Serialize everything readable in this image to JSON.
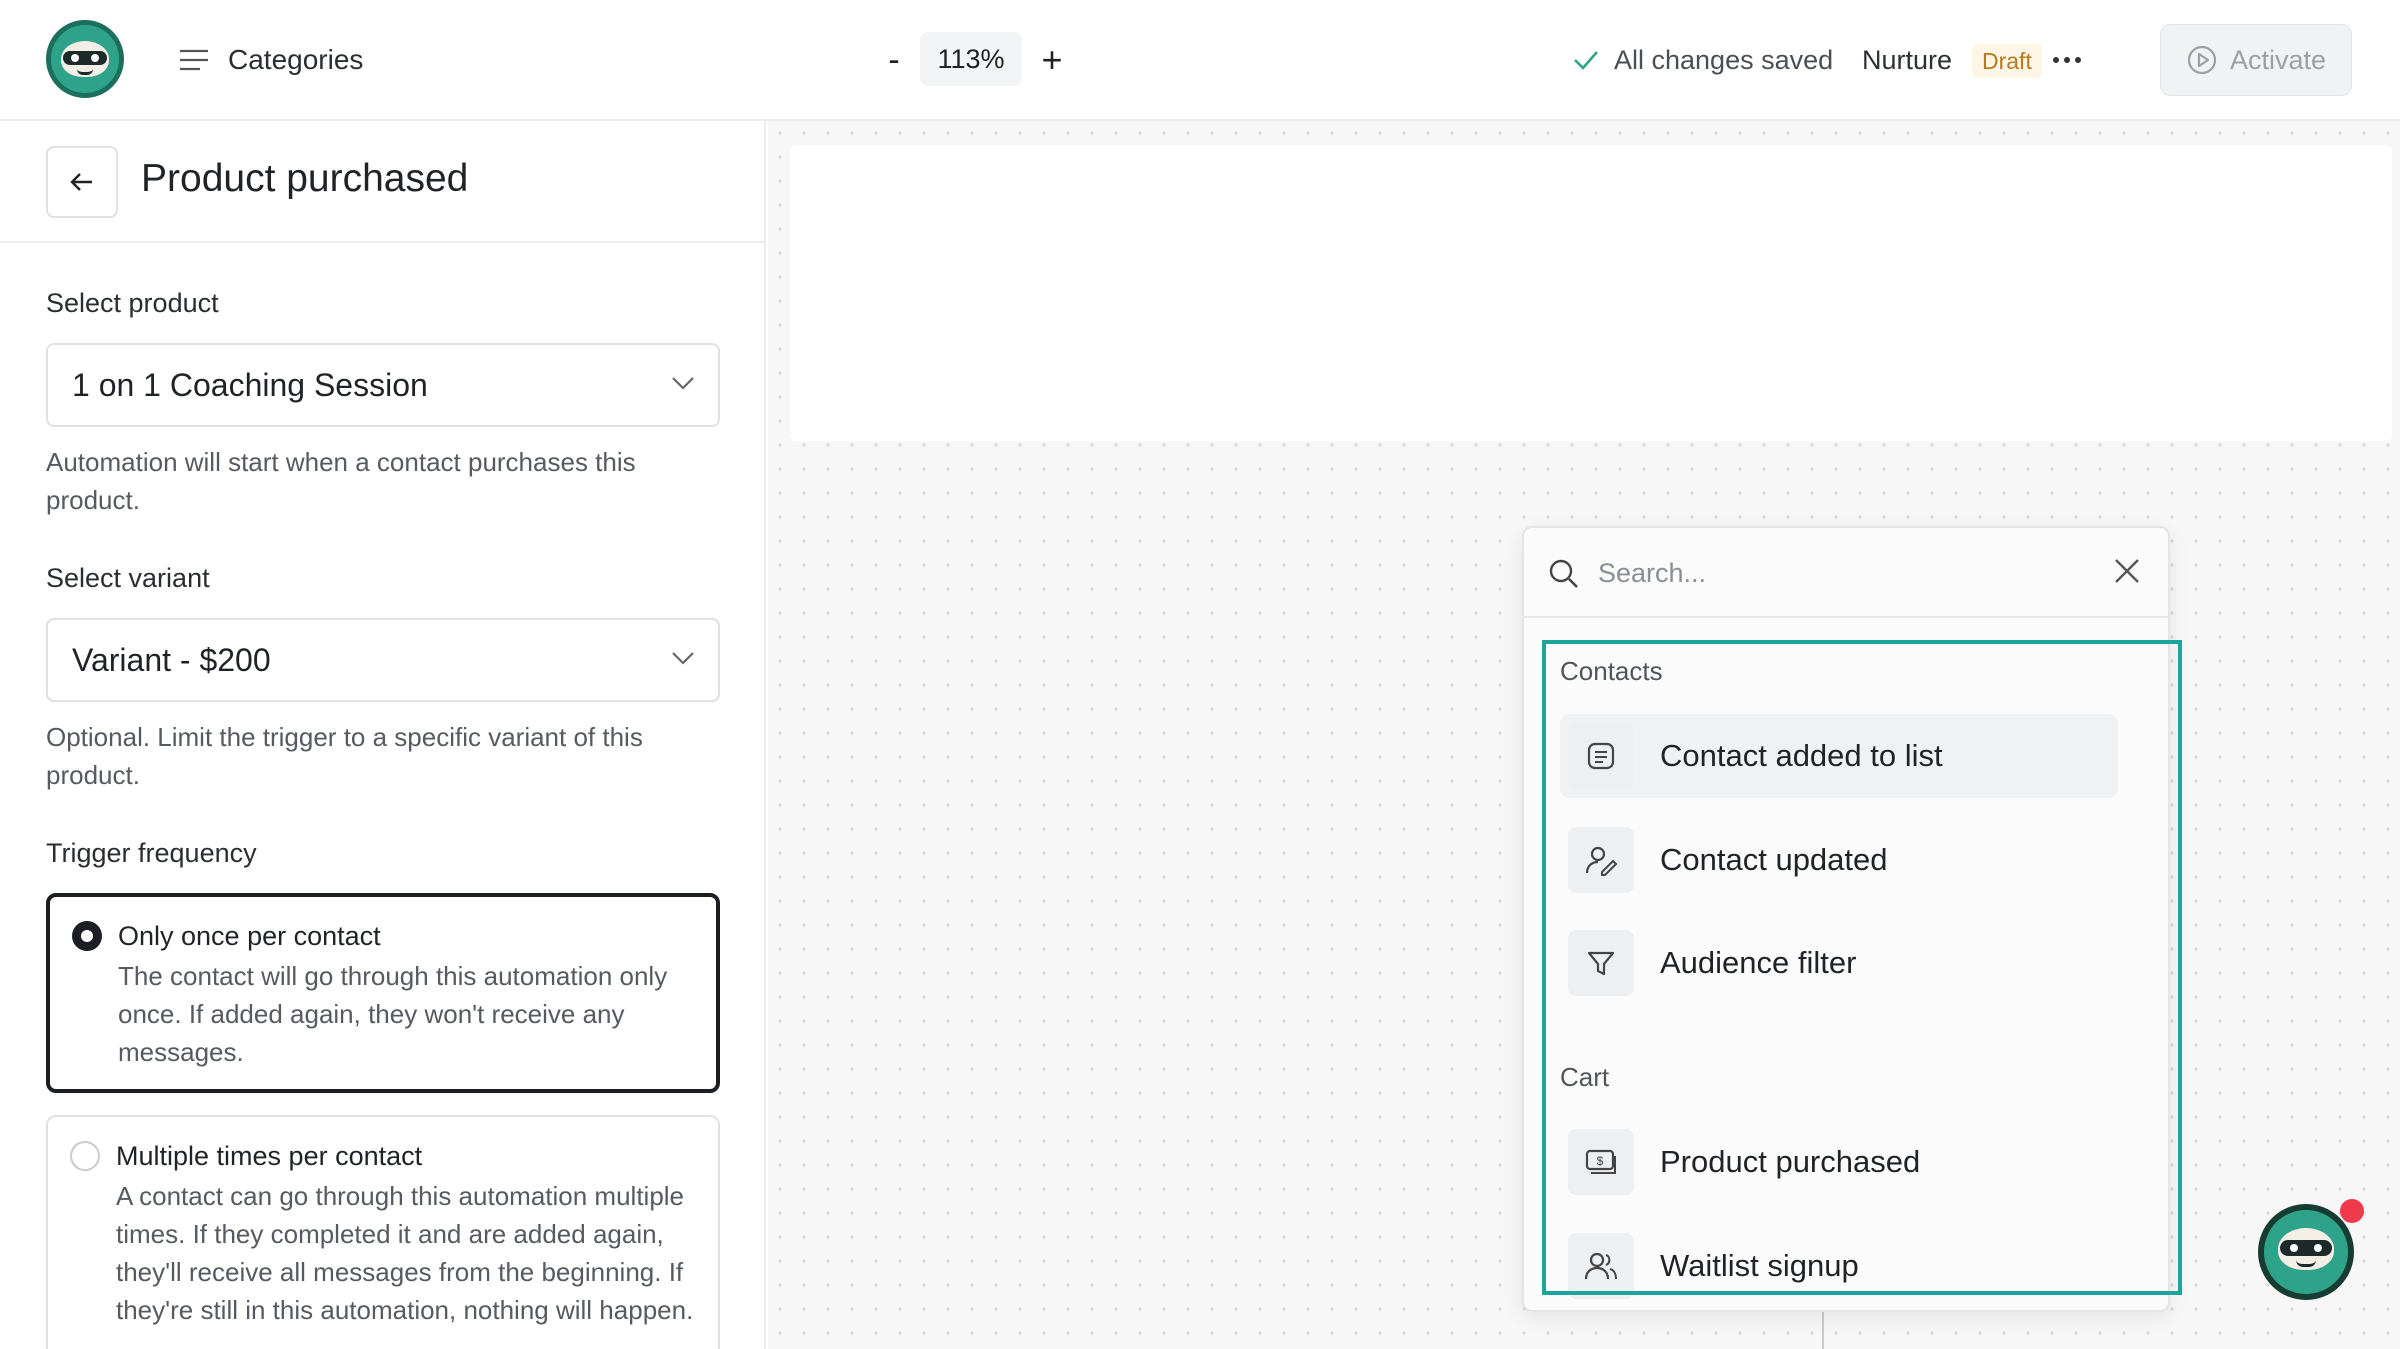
{
  "header": {
    "menu_label": "Categories",
    "zoom_minus": "-",
    "zoom_value": "113%",
    "zoom_plus": "+",
    "save_status": "All changes saved",
    "workflow_name": "Nurture",
    "status_badge": "Draft",
    "activate_label": "Activate"
  },
  "panel": {
    "title": "Product purchased",
    "product_label": "Select product",
    "product_value": "1 on 1 Coaching Session",
    "product_hint": "Automation will start when a contact purchases this product.",
    "variant_label": "Select variant",
    "variant_value": "Variant - $200",
    "variant_hint": "Optional. Limit the trigger to a specific variant of this product.",
    "frequency_label": "Trigger frequency",
    "options": [
      {
        "title": "Only once per contact",
        "desc": "The contact will go through this automation only once. If added again, they won't receive any messages.",
        "selected": true
      },
      {
        "title": "Multiple times per contact",
        "desc": "A contact can go through this automation multiple times. If they completed it and are added again, they'll receive all messages from the beginning. If they're still in this automation, nothing will happen.",
        "selected": false
      }
    ]
  },
  "dropdown": {
    "search_placeholder": "Search...",
    "groups": [
      {
        "label": "Contacts",
        "items": [
          {
            "label": "Contact added to list",
            "icon": "list-icon"
          },
          {
            "label": "Contact updated",
            "icon": "user-edit-icon"
          },
          {
            "label": "Audience filter",
            "icon": "filter-icon"
          }
        ]
      },
      {
        "label": "Cart",
        "items": [
          {
            "label": "Product purchased",
            "icon": "money-icon"
          },
          {
            "label": "Waitlist signup",
            "icon": "users-icon"
          }
        ]
      }
    ]
  },
  "colors": {
    "brand": "#2fa389",
    "highlight": "#1fa39c",
    "draft_text": "#b7791f",
    "notification": "#ee3a4b"
  }
}
